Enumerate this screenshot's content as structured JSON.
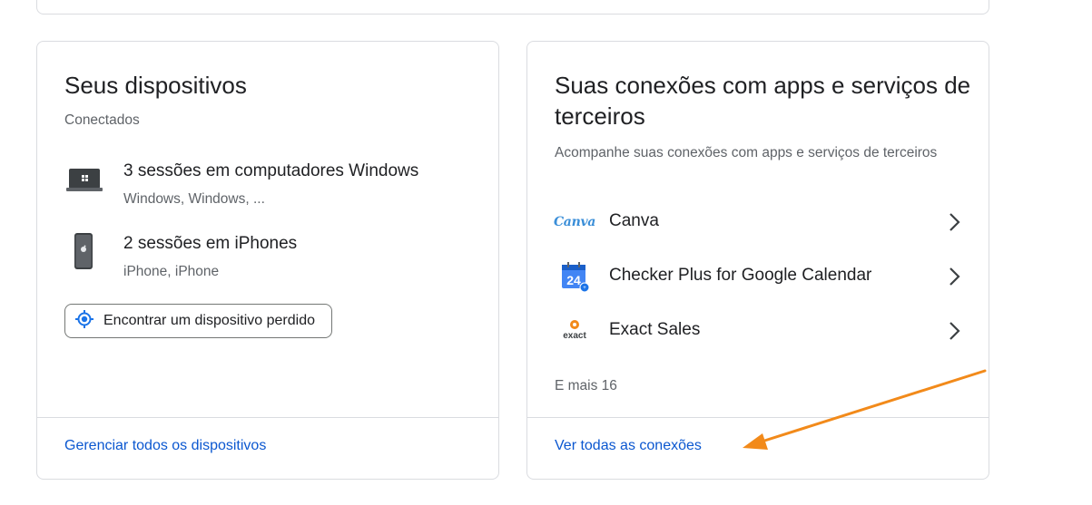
{
  "devices_card": {
    "title": "Seus dispositivos",
    "subtitle": "Conectados",
    "items": [
      {
        "icon": "laptop-windows-icon",
        "main": "3 sessões em computadores Windows",
        "sub": "Windows, Windows, ..."
      },
      {
        "icon": "iphone-icon",
        "main": "2 sessões em iPhones",
        "sub": "iPhone, iPhone"
      }
    ],
    "find_button_label": "Encontrar um dispositivo perdido",
    "footer_link": "Gerenciar todos os dispositivos"
  },
  "connections_card": {
    "title": "Suas conexões com apps e serviços de terceiros",
    "subtitle": "Acompanhe suas conexões com apps e serviços de terceiros",
    "apps": [
      {
        "icon": "canva-logo",
        "logo_text": "Canva",
        "name": "Canva"
      },
      {
        "icon": "checker-plus-calendar-icon",
        "logo_text": "24",
        "name": "Checker Plus for Google Calendar"
      },
      {
        "icon": "exact-sales-logo",
        "logo_text": "exact",
        "name": "Exact Sales"
      }
    ],
    "more_text": "E mais 16",
    "footer_link": "Ver todas as conexões"
  },
  "colors": {
    "link": "#0b57d0",
    "border": "#dadce0",
    "annotation_arrow": "#f28a1a"
  }
}
